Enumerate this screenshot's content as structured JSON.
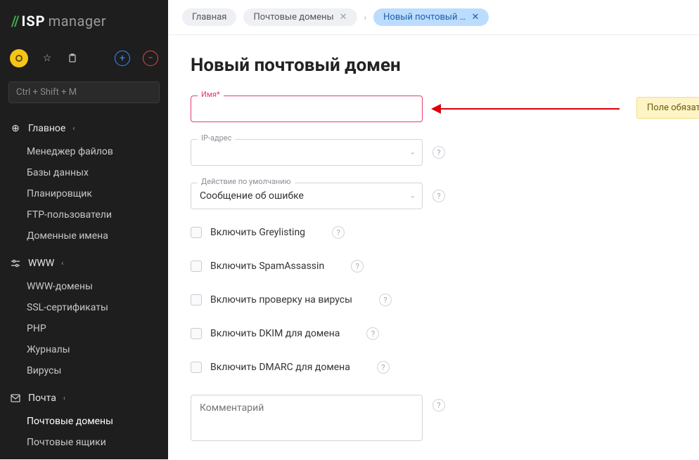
{
  "logo": {
    "slashes": "//",
    "isp": "ISP",
    "manager": "manager"
  },
  "search": {
    "placeholder": "Ctrl + Shift + M"
  },
  "nav": {
    "main": {
      "label": "Главное",
      "items": [
        "Менеджер файлов",
        "Базы данных",
        "Планировщик",
        "FTP-пользователи",
        "Доменные имена"
      ]
    },
    "www": {
      "label": "WWW",
      "items": [
        "WWW-домены",
        "SSL-сертификаты",
        "PHP",
        "Журналы",
        "Вирусы"
      ]
    },
    "mail": {
      "label": "Почта",
      "items": [
        "Почтовые домены",
        "Почтовые ящики"
      ]
    }
  },
  "breadcrumb": [
    {
      "label": "Главная",
      "closable": false
    },
    {
      "label": "Почтовые домены",
      "closable": true
    },
    {
      "label": "Новый почтовый …",
      "closable": true,
      "active": true
    }
  ],
  "page": {
    "title": "Новый почтовый домен"
  },
  "fields": {
    "name": {
      "label": "Имя*"
    },
    "ip": {
      "label": "IP-адрес"
    },
    "default_action": {
      "label": "Действие по умолчанию",
      "value": "Сообщение об ошибке"
    },
    "comment": {
      "placeholder": "Комментарий"
    }
  },
  "error_tooltip": {
    "text": "Поле обязательно для заполнения"
  },
  "checks": {
    "greylisting": "Включить Greylisting",
    "spamassassin": "Включить SpamAssassin",
    "virus": "Включить проверку на вирусы",
    "dkim": "Включить DKIM для домена",
    "dmarc": "Включить DMARC для домена"
  }
}
